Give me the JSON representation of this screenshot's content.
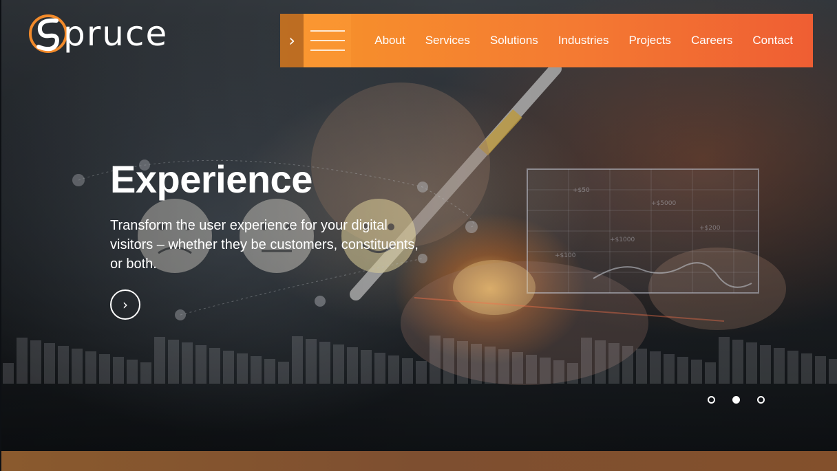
{
  "brand": {
    "logo_text": "pruce",
    "logo_alt": "Spruce",
    "colors": {
      "accent_start": "#f7942a",
      "accent_end": "#ef5e33"
    }
  },
  "nav": {
    "toggle_icon": "chevron-right-icon",
    "menu_icon": "hamburger-icon",
    "items": [
      {
        "label": "About"
      },
      {
        "label": "Services"
      },
      {
        "label": "Solutions"
      },
      {
        "label": "Industries"
      },
      {
        "label": "Projects"
      },
      {
        "label": "Careers"
      },
      {
        "label": "Contact"
      }
    ]
  },
  "hero": {
    "title": "Experience",
    "description": "Transform the user experience for your digital visitors – whether they be customers, constituents, or both.",
    "cta_icon": "chevron-right-icon",
    "slider": {
      "count": 3,
      "active_index": 1
    }
  },
  "overlay": {
    "price_labels": [
      "+$50",
      "+$5000",
      "+$1000",
      "+$100",
      "+$200"
    ]
  }
}
